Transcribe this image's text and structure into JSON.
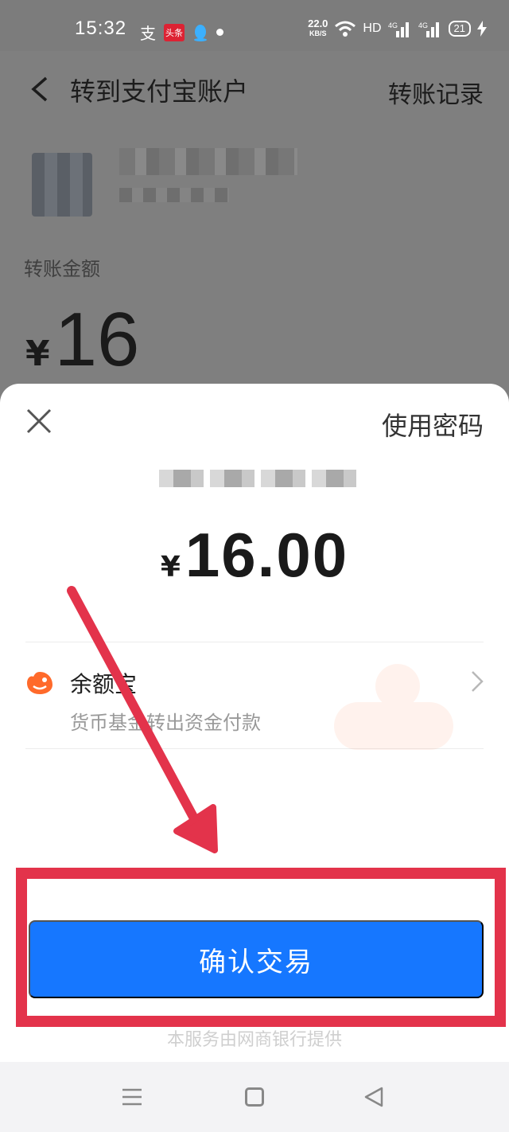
{
  "status_bar": {
    "time": "15:32",
    "app_icons": [
      "alipay-icon",
      "toutiao-icon",
      "qq-icon"
    ],
    "toutiao_text": "头条",
    "net_speed": "22.0",
    "net_speed_unit": "KB/S",
    "hd_label": "HD",
    "battery": "21"
  },
  "page": {
    "title": "转到支付宝账户",
    "history_link": "转账记录",
    "amount_label": "转账金额",
    "amount_currency": "¥",
    "amount_value": "16"
  },
  "sheet": {
    "use_password": "使用密码",
    "amount_currency": "¥",
    "amount_value": "16.00",
    "payment_method": {
      "name": "余额宝",
      "description": "货币基金转出资金付款"
    },
    "confirm_button": "确认交易",
    "provider_note": "本服务由网商银行提供"
  },
  "colors": {
    "primary": "#1677ff",
    "annotation": "#e3334b",
    "overlay": "#7f7f7f"
  }
}
